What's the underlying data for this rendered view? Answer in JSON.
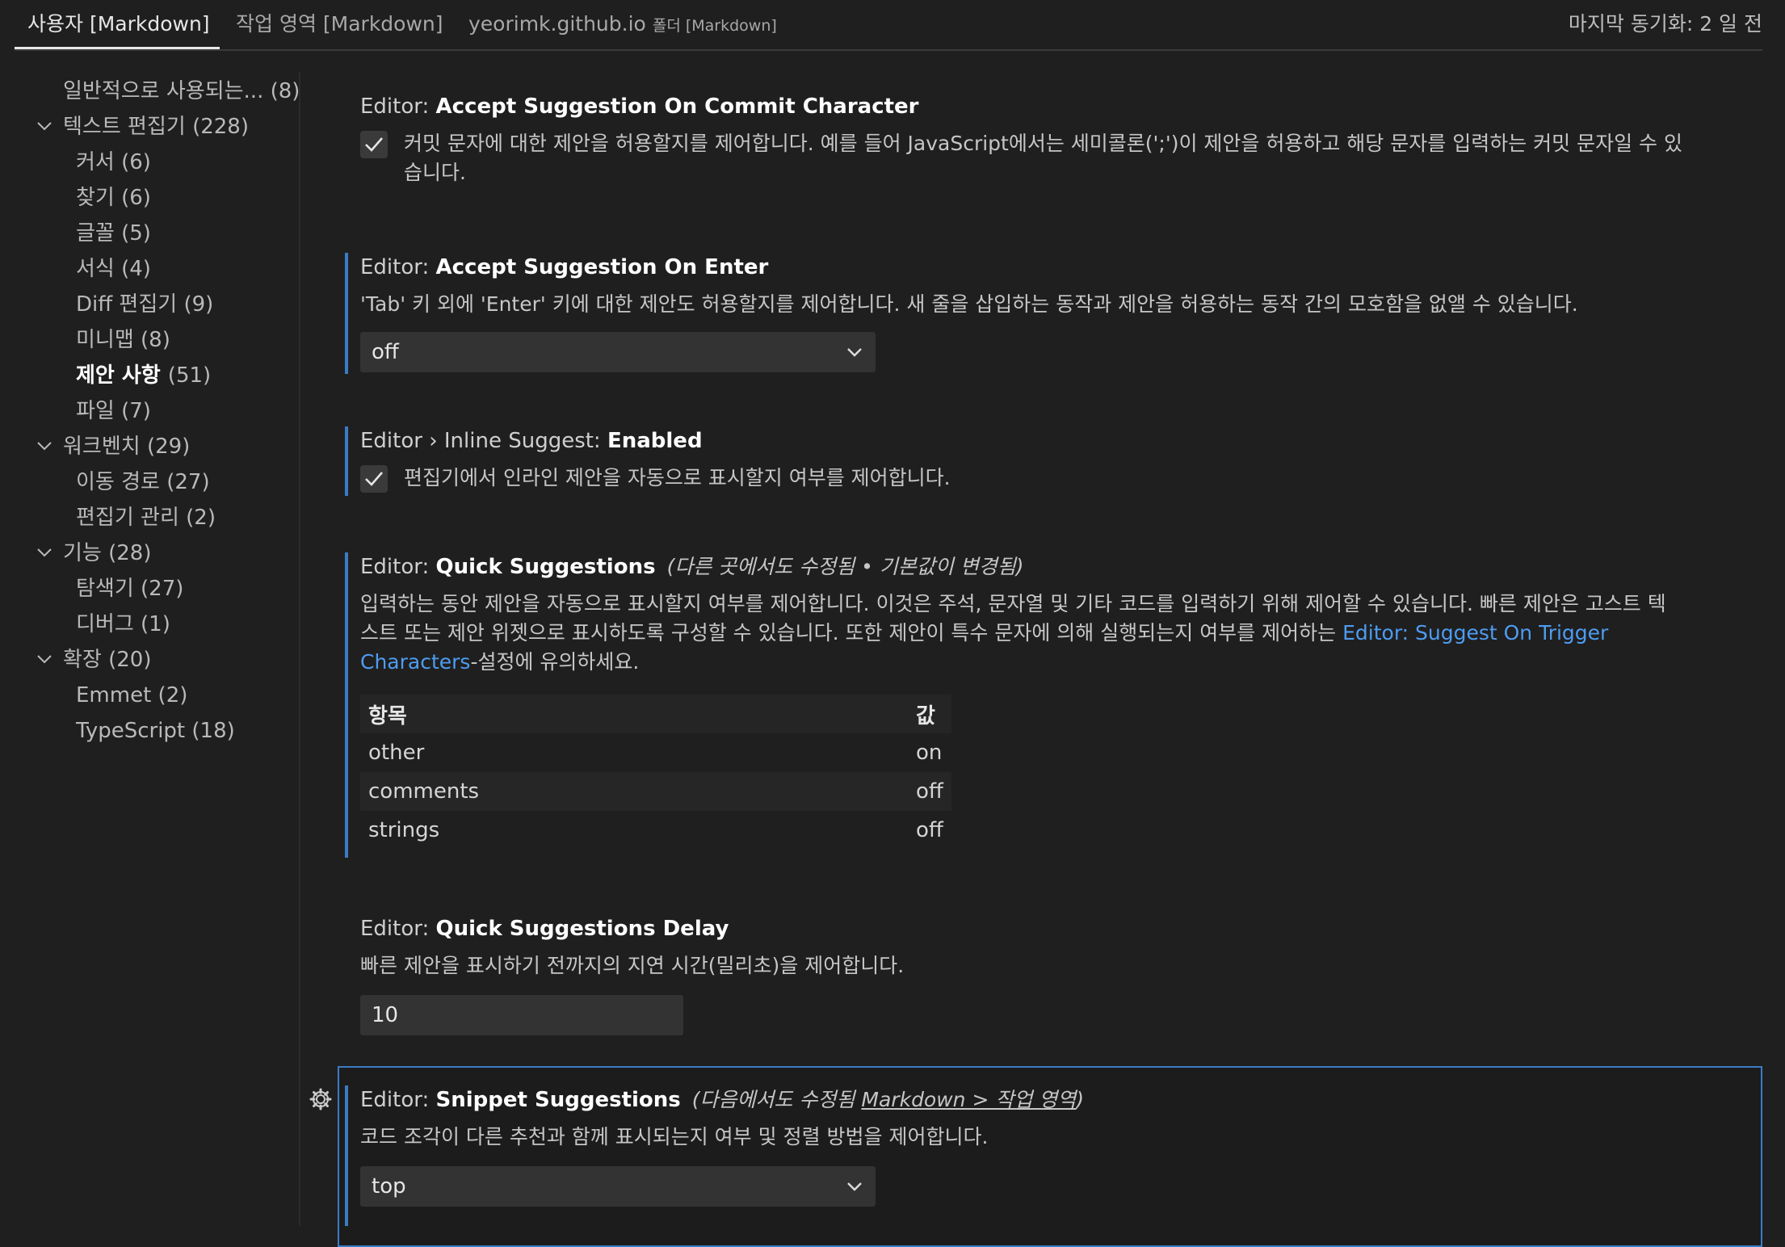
{
  "tabs": [
    {
      "label": "사용자 [Markdown]",
      "active": true
    },
    {
      "label": "작업 영역 [Markdown]"
    },
    {
      "label": "yeorimk.github.io",
      "sub": "폴더 [Markdown]"
    }
  ],
  "sync_status": "마지막 동기화: 2 일 전",
  "toc": [
    {
      "label": "일반적으로 사용되는...",
      "count": "(8)"
    },
    {
      "label": "텍스트 편집기",
      "count": "(228)",
      "expanded": true
    },
    {
      "label": "커서",
      "count": "(6)"
    },
    {
      "label": "찾기",
      "count": "(6)"
    },
    {
      "label": "글꼴",
      "count": "(5)"
    },
    {
      "label": "서식",
      "count": "(4)"
    },
    {
      "label": "Diff 편집기",
      "count": "(9)"
    },
    {
      "label": "미니맵",
      "count": "(8)"
    },
    {
      "label": "제안 사항",
      "count": "(51)",
      "selected": true
    },
    {
      "label": "파일",
      "count": "(7)"
    },
    {
      "label": "워크벤치",
      "count": "(29)",
      "expanded": true
    },
    {
      "label": "이동 경로",
      "count": "(27)"
    },
    {
      "label": "편집기 관리",
      "count": "(2)"
    },
    {
      "label": "기능",
      "count": "(28)",
      "expanded": true
    },
    {
      "label": "탐색기",
      "count": "(27)"
    },
    {
      "label": "디버그",
      "count": "(1)"
    },
    {
      "label": "확장",
      "count": "(20)",
      "expanded": true
    },
    {
      "label": "Emmet",
      "count": "(2)"
    },
    {
      "label": "TypeScript",
      "count": "(18)"
    }
  ],
  "settings": {
    "commit_char": {
      "category": "Editor: ",
      "name": "Accept Suggestion On Commit Character",
      "desc_line1": "커밋 문자에 대한 제안을 허용할지를 제어합니다. 예를 들어 JavaScript에서는 세미콜론(';')이 제안을 허용하고 해당 문자를 입력하는 커밋 문자일 수 있",
      "desc_line2": "습니다.",
      "checked": true
    },
    "on_enter": {
      "category": "Editor: ",
      "name": "Accept Suggestion On Enter",
      "desc": "'Tab' 키 외에 'Enter' 키에 대한 제안도 허용할지를 제어합니다. 새 줄을 삽입하는 동작과 제안을 허용하는 동작 간의 모호함을 없앨 수 있습니다.",
      "value": "off"
    },
    "inline": {
      "category": "Editor › Inline Suggest: ",
      "name": "Enabled",
      "desc": "편집기에서 인라인 제안을 자동으로 표시할지 여부를 제어합니다.",
      "checked": true
    },
    "quick": {
      "category": "Editor: ",
      "name": "Quick Suggestions",
      "note": "(다른 곳에서도 수정됨 • 기본값이 변경됨)",
      "desc_line1": "입력하는 동안 제안을 자동으로 표시할지 여부를 제어합니다. 이것은 주석, 문자열 및 기타 코드를 입력하기 위해 제어할 수 있습니다. 빠른 제안은 고스트 텍",
      "desc_line2a": "스트 또는 제안 위젯으로 표시하도록 구성할 수 있습니다. 또한 제안이 특수 문자에 의해 실행되는지 여부를 제어하는 ",
      "desc_link_a": "Editor: Suggest On Trigger",
      "desc_link_b": "Characters",
      "desc_line3": "-설정에 유의하세요.",
      "table_headers": [
        "항목",
        "값"
      ],
      "rows": [
        [
          "other",
          "on"
        ],
        [
          "comments",
          "off"
        ],
        [
          "strings",
          "off"
        ]
      ]
    },
    "delay": {
      "category": "Editor: ",
      "name": "Quick Suggestions Delay",
      "desc": "빠른 제안을 표시하기 전까지의 지연 시간(밀리초)을 제어합니다.",
      "value": "10"
    },
    "snippet": {
      "category": "Editor: ",
      "name": "Snippet Suggestions",
      "note_prefix": "(다음에서도 수정됨 ",
      "note_link": "Markdown > 작업 영역",
      "note_suffix": ")",
      "desc": "코드 조각이 다른 추천과 함께 표시되는지 여부 및 정렬 방법을 제어합니다.",
      "value": "top"
    }
  },
  "colors": {
    "accent": "#3a7cc4",
    "link": "#4e9cf1",
    "background": "#1f1f1f"
  }
}
